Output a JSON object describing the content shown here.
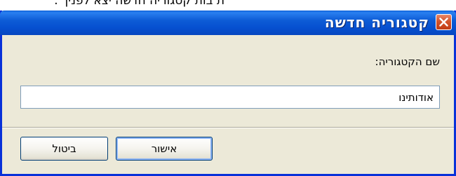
{
  "header_strip": {
    "text": "ת בות קטגוריה חדשה יצא לפניך :"
  },
  "dialog": {
    "title": "קטגוריה חדשה",
    "field_label": "שם הקטגוריה:",
    "field_value": "אודותינו",
    "ok_label": "אישור",
    "cancel_label": "ביטול"
  },
  "icons": {
    "close": "close-icon"
  },
  "colors": {
    "titlebar": "#0650d0",
    "window_frame": "#0831d9",
    "dialog_background": "#ece9d8",
    "close_button": "#d3532b"
  }
}
